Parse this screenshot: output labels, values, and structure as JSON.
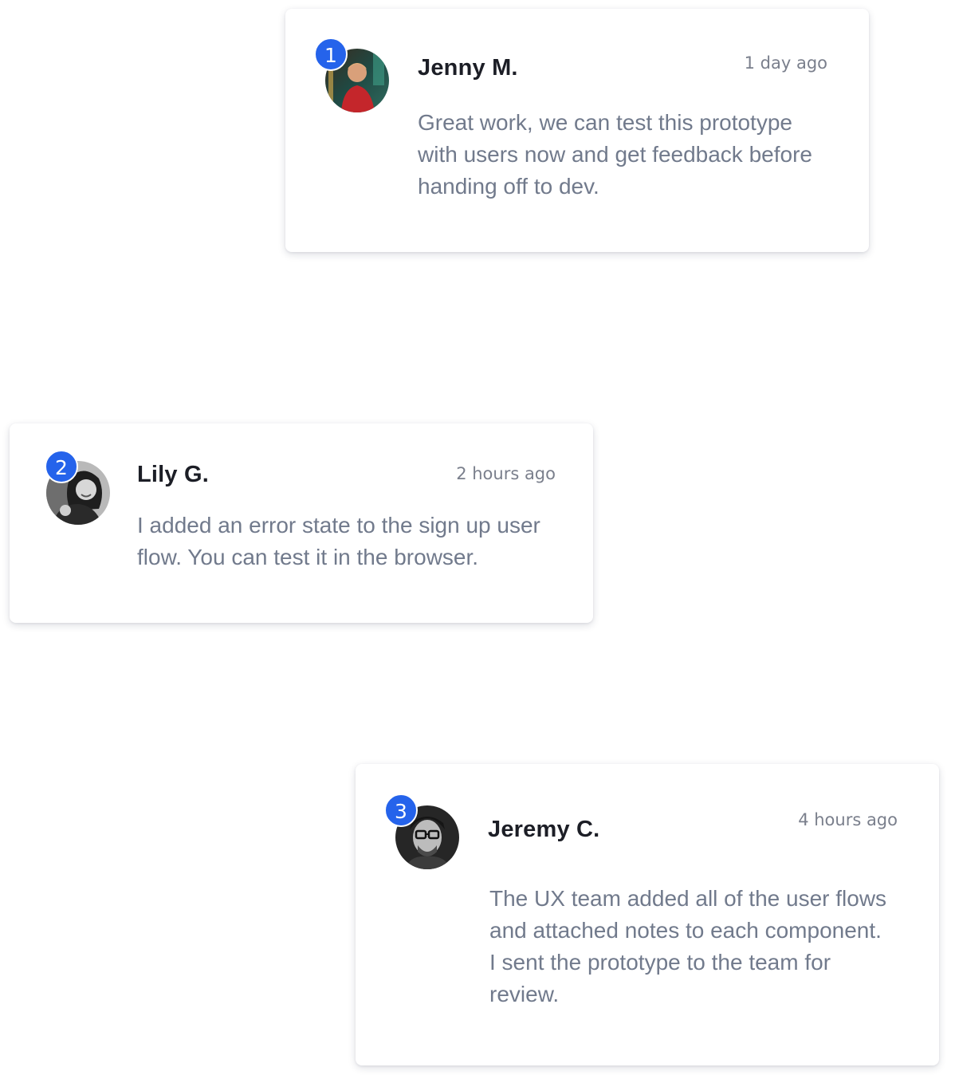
{
  "comments": [
    {
      "number": "1",
      "author": "Jenny M.",
      "time": "1 day ago",
      "message": "Great work, we can test this prototype with users now and get feedback before handing off to dev.",
      "avatar": "jenny-avatar"
    },
    {
      "number": "2",
      "author": "Lily G.",
      "time": "2 hours ago",
      "message": "I added an error state to the sign up user flow. You can test it in the browser.",
      "avatar": "lily-avatar"
    },
    {
      "number": "3",
      "author": "Jeremy C.",
      "time": "4 hours ago",
      "message": "The UX team added all of the user flows and attached notes to each component.  I sent the prototype to the team for review.",
      "avatar": "jeremy-avatar"
    }
  ],
  "colors": {
    "badge": "#2563eb",
    "name": "#1c1e26",
    "time": "#7a7f8c",
    "message": "#717a8c"
  }
}
